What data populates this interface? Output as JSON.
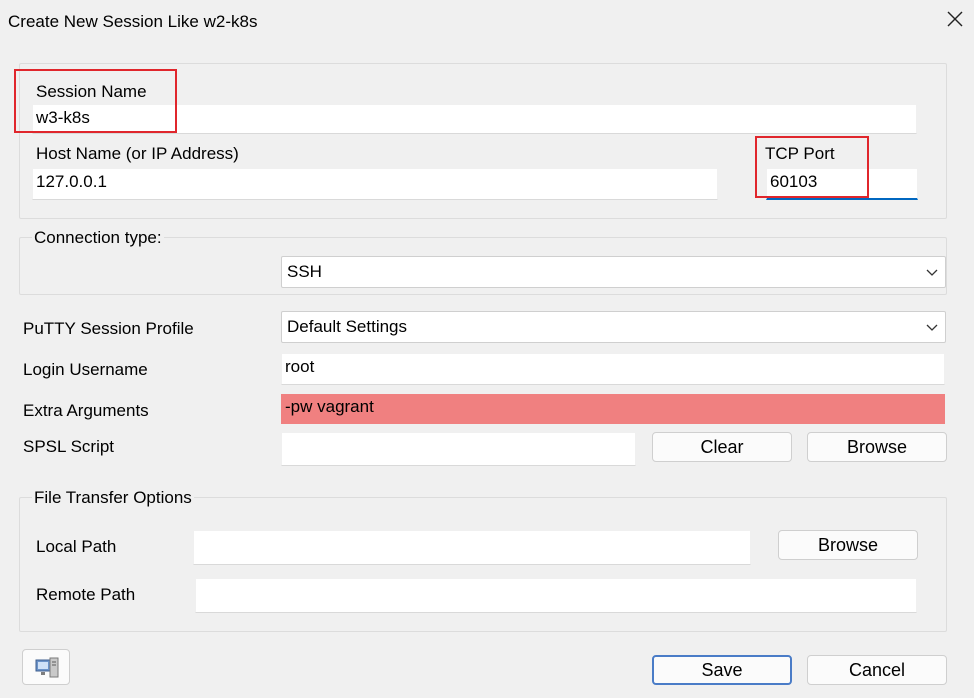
{
  "window": {
    "title": "Create New Session Like w2-k8s",
    "close_glyph": "✕"
  },
  "session": {
    "name_label": "Session Name",
    "name_value": "w3-k8s",
    "host_label": "Host Name (or IP Address)",
    "host_value": "127.0.0.1",
    "port_label": "TCP Port",
    "port_value": "60103"
  },
  "connection": {
    "legend": "Connection type:",
    "type_value": "SSH"
  },
  "settings": {
    "profile_label": "PuTTY Session Profile",
    "profile_value": "Default Settings",
    "username_label": "Login Username",
    "username_value": "root",
    "extra_label": "Extra Arguments",
    "extra_value": "-pw vagrant",
    "spsl_label": "SPSL Script",
    "spsl_value": "",
    "clear_label": "Clear",
    "browse_label": "Browse"
  },
  "file_transfer": {
    "legend": "File Transfer Options",
    "local_label": "Local Path",
    "local_value": "",
    "browse_label": "Browse",
    "remote_label": "Remote Path",
    "remote_value": ""
  },
  "footer": {
    "icon": "computer-monitor-icon",
    "save_label": "Save",
    "cancel_label": "Cancel"
  },
  "colors": {
    "highlight": "#f08080",
    "annotation_box": "#e0262c",
    "focus_underline": "#0067c0",
    "default_button_border": "#4a7cc7"
  }
}
